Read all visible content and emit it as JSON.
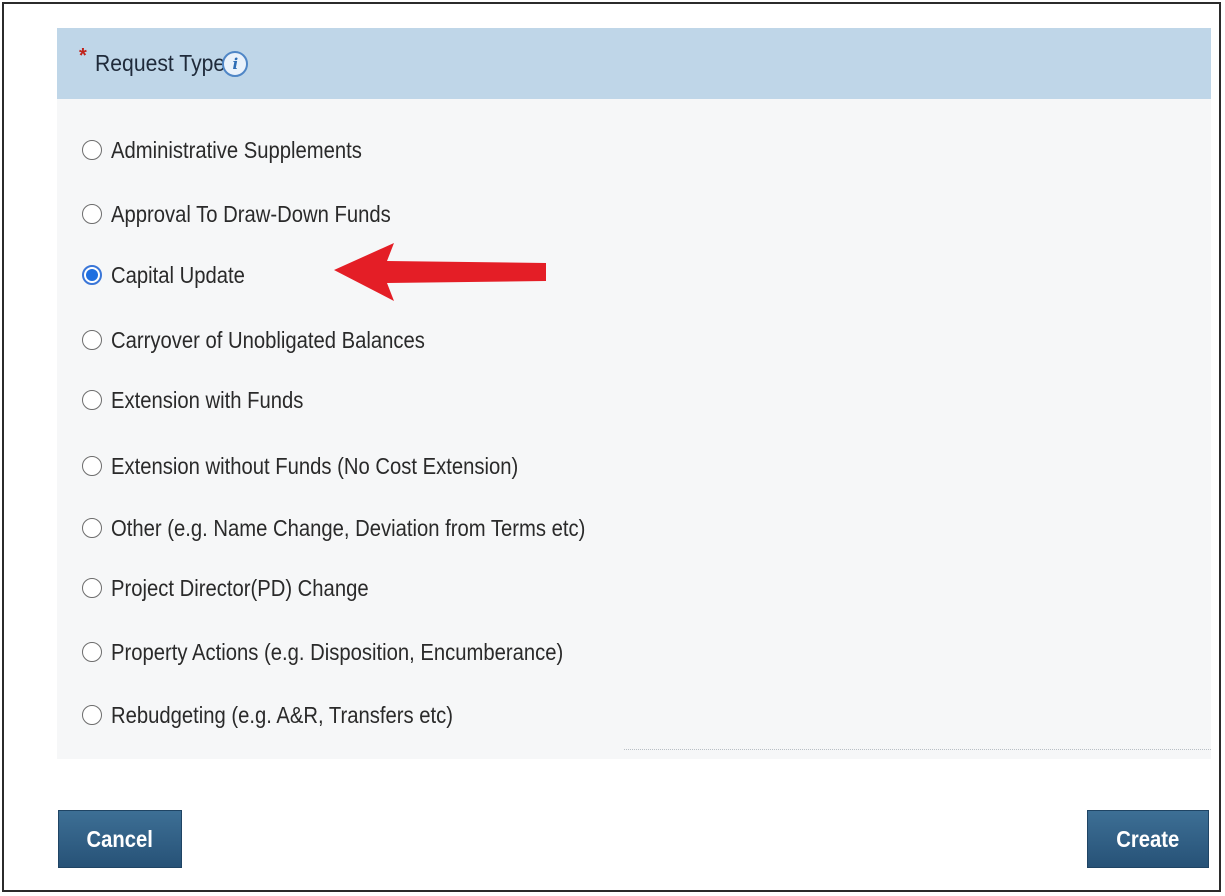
{
  "section": {
    "required_marker": "*",
    "title": "Request Type",
    "info_icon": "i"
  },
  "options": [
    {
      "label": "Administrative Supplements",
      "selected": false
    },
    {
      "label": "Approval To Draw-Down Funds",
      "selected": false
    },
    {
      "label": "Capital Update",
      "selected": true
    },
    {
      "label": "Carryover of Unobligated Balances",
      "selected": false
    },
    {
      "label": "Extension with Funds",
      "selected": false
    },
    {
      "label": "Extension without Funds (No Cost Extension)",
      "selected": false
    },
    {
      "label": "Other (e.g. Name Change, Deviation from Terms etc)",
      "selected": false
    },
    {
      "label": "Project Director(PD) Change",
      "selected": false
    },
    {
      "label": "Property Actions (e.g. Disposition, Encumberance)",
      "selected": false
    },
    {
      "label": "Rebudgeting (e.g. A&R, Transfers etc)",
      "selected": false
    }
  ],
  "buttons": {
    "cancel": "Cancel",
    "create": "Create"
  },
  "colors": {
    "header_bg": "#bfd6e8",
    "button_bg": "#2f5f86",
    "arrow": "#e41e26",
    "selected_radio": "#1f6fe0"
  },
  "annotation": {
    "arrow_icon": "red-arrow-left"
  }
}
